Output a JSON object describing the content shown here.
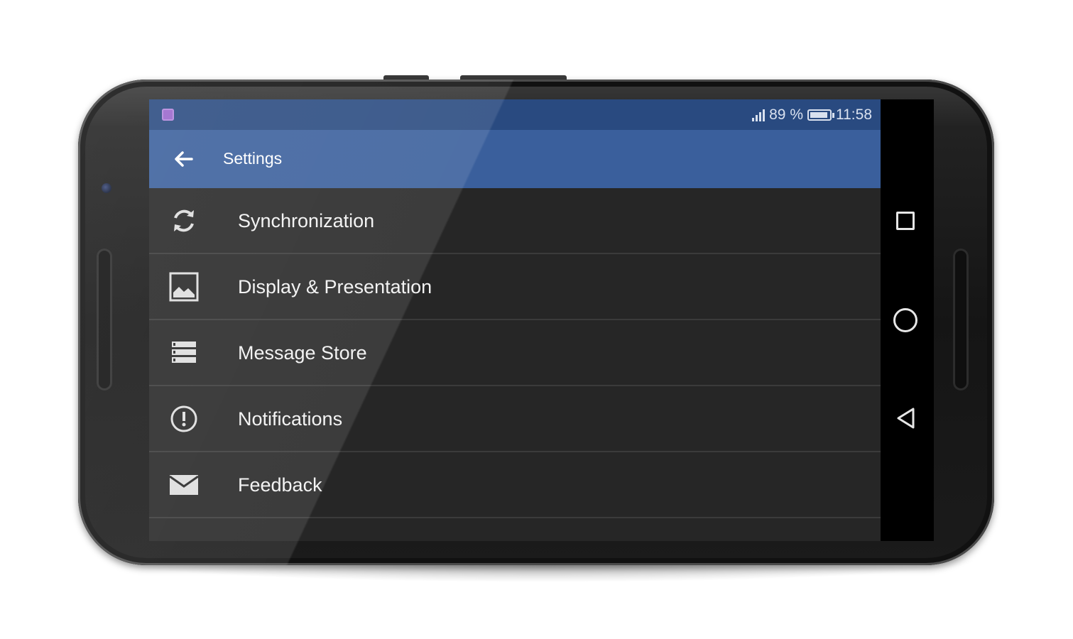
{
  "status_bar": {
    "battery_percent": "89 %",
    "time": "11:58"
  },
  "app_bar": {
    "title": "Settings"
  },
  "settings_items": [
    {
      "label": "Synchronization",
      "icon": "sync-icon"
    },
    {
      "label": "Display & Presentation",
      "icon": "image-icon"
    },
    {
      "label": "Message Store",
      "icon": "storage-list-icon"
    },
    {
      "label": "Notifications",
      "icon": "alert-circle-icon"
    },
    {
      "label": "Feedback",
      "icon": "envelope-icon"
    }
  ],
  "navigation": {
    "buttons": [
      "recents-icon",
      "home-icon",
      "back-icon"
    ]
  },
  "colors": {
    "status_bar": "#294a80",
    "app_bar": "#3a5f9c",
    "background": "#262626"
  }
}
